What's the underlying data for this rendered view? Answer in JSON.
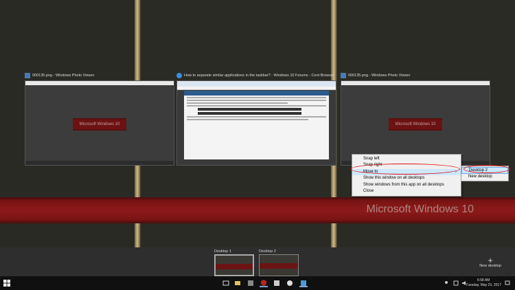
{
  "windows": [
    {
      "title": "000135.png - Windows Photo Viewer",
      "inner_text": "Microsoft Windows 10"
    },
    {
      "title": "How to separate similar applications in the taskbar? - Windows 10 Forums - Cent Browser"
    },
    {
      "title": "000135.png - Windows Photo Viewer",
      "inner_text": "Microsoft Windows 10"
    }
  ],
  "background_brand": "Microsoft Windows 10",
  "context_menu": {
    "items": [
      {
        "label": "Snap left"
      },
      {
        "label": "Snap right"
      },
      {
        "label": "Move to",
        "arrow": "›"
      },
      {
        "label": "Show this window on all desktops"
      },
      {
        "label": "Show windows from this app on all desktops"
      },
      {
        "label": "Close"
      }
    ],
    "submenu": [
      {
        "label": "Desktop 2"
      },
      {
        "label": "New desktop"
      }
    ]
  },
  "desktops": [
    {
      "label": "Desktop 1"
    },
    {
      "label": "Desktop 2"
    }
  ],
  "new_desktop": {
    "label": "New desktop",
    "icon": "+"
  },
  "clock": {
    "time": "6:58 AM",
    "date": "Tuesday, May 23, 2017"
  },
  "colors": {
    "accent": "#cde8ff",
    "highlight_ring": "#e01010"
  }
}
